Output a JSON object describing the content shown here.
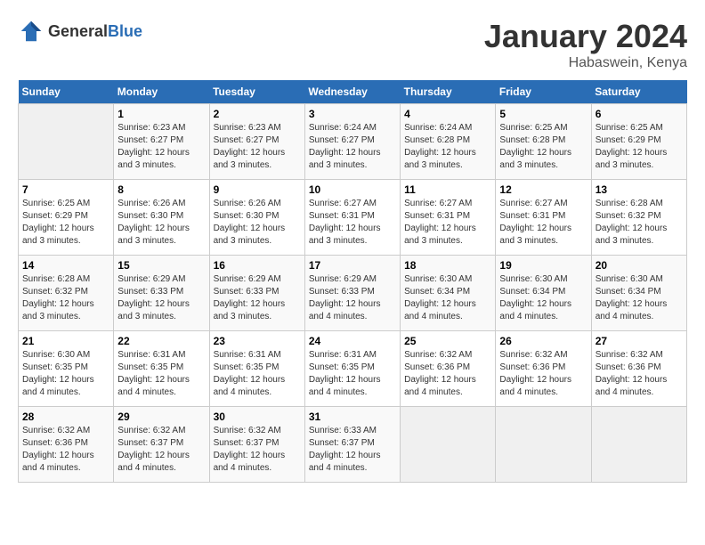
{
  "header": {
    "logo_general": "General",
    "logo_blue": "Blue",
    "month_title": "January 2024",
    "location": "Habaswein, Kenya"
  },
  "days_of_week": [
    "Sunday",
    "Monday",
    "Tuesday",
    "Wednesday",
    "Thursday",
    "Friday",
    "Saturday"
  ],
  "weeks": [
    [
      {
        "day": "",
        "empty": true
      },
      {
        "day": "1",
        "sunrise": "6:23 AM",
        "sunset": "6:27 PM",
        "daylight": "12 hours and 3 minutes."
      },
      {
        "day": "2",
        "sunrise": "6:23 AM",
        "sunset": "6:27 PM",
        "daylight": "12 hours and 3 minutes."
      },
      {
        "day": "3",
        "sunrise": "6:24 AM",
        "sunset": "6:27 PM",
        "daylight": "12 hours and 3 minutes."
      },
      {
        "day": "4",
        "sunrise": "6:24 AM",
        "sunset": "6:28 PM",
        "daylight": "12 hours and 3 minutes."
      },
      {
        "day": "5",
        "sunrise": "6:25 AM",
        "sunset": "6:28 PM",
        "daylight": "12 hours and 3 minutes."
      },
      {
        "day": "6",
        "sunrise": "6:25 AM",
        "sunset": "6:29 PM",
        "daylight": "12 hours and 3 minutes."
      }
    ],
    [
      {
        "day": "7",
        "sunrise": "6:25 AM",
        "sunset": "6:29 PM",
        "daylight": "12 hours and 3 minutes."
      },
      {
        "day": "8",
        "sunrise": "6:26 AM",
        "sunset": "6:30 PM",
        "daylight": "12 hours and 3 minutes."
      },
      {
        "day": "9",
        "sunrise": "6:26 AM",
        "sunset": "6:30 PM",
        "daylight": "12 hours and 3 minutes."
      },
      {
        "day": "10",
        "sunrise": "6:27 AM",
        "sunset": "6:31 PM",
        "daylight": "12 hours and 3 minutes."
      },
      {
        "day": "11",
        "sunrise": "6:27 AM",
        "sunset": "6:31 PM",
        "daylight": "12 hours and 3 minutes."
      },
      {
        "day": "12",
        "sunrise": "6:27 AM",
        "sunset": "6:31 PM",
        "daylight": "12 hours and 3 minutes."
      },
      {
        "day": "13",
        "sunrise": "6:28 AM",
        "sunset": "6:32 PM",
        "daylight": "12 hours and 3 minutes."
      }
    ],
    [
      {
        "day": "14",
        "sunrise": "6:28 AM",
        "sunset": "6:32 PM",
        "daylight": "12 hours and 3 minutes."
      },
      {
        "day": "15",
        "sunrise": "6:29 AM",
        "sunset": "6:33 PM",
        "daylight": "12 hours and 3 minutes."
      },
      {
        "day": "16",
        "sunrise": "6:29 AM",
        "sunset": "6:33 PM",
        "daylight": "12 hours and 3 minutes."
      },
      {
        "day": "17",
        "sunrise": "6:29 AM",
        "sunset": "6:33 PM",
        "daylight": "12 hours and 4 minutes."
      },
      {
        "day": "18",
        "sunrise": "6:30 AM",
        "sunset": "6:34 PM",
        "daylight": "12 hours and 4 minutes."
      },
      {
        "day": "19",
        "sunrise": "6:30 AM",
        "sunset": "6:34 PM",
        "daylight": "12 hours and 4 minutes."
      },
      {
        "day": "20",
        "sunrise": "6:30 AM",
        "sunset": "6:34 PM",
        "daylight": "12 hours and 4 minutes."
      }
    ],
    [
      {
        "day": "21",
        "sunrise": "6:30 AM",
        "sunset": "6:35 PM",
        "daylight": "12 hours and 4 minutes."
      },
      {
        "day": "22",
        "sunrise": "6:31 AM",
        "sunset": "6:35 PM",
        "daylight": "12 hours and 4 minutes."
      },
      {
        "day": "23",
        "sunrise": "6:31 AM",
        "sunset": "6:35 PM",
        "daylight": "12 hours and 4 minutes."
      },
      {
        "day": "24",
        "sunrise": "6:31 AM",
        "sunset": "6:35 PM",
        "daylight": "12 hours and 4 minutes."
      },
      {
        "day": "25",
        "sunrise": "6:32 AM",
        "sunset": "6:36 PM",
        "daylight": "12 hours and 4 minutes."
      },
      {
        "day": "26",
        "sunrise": "6:32 AM",
        "sunset": "6:36 PM",
        "daylight": "12 hours and 4 minutes."
      },
      {
        "day": "27",
        "sunrise": "6:32 AM",
        "sunset": "6:36 PM",
        "daylight": "12 hours and 4 minutes."
      }
    ],
    [
      {
        "day": "28",
        "sunrise": "6:32 AM",
        "sunset": "6:36 PM",
        "daylight": "12 hours and 4 minutes."
      },
      {
        "day": "29",
        "sunrise": "6:32 AM",
        "sunset": "6:37 PM",
        "daylight": "12 hours and 4 minutes."
      },
      {
        "day": "30",
        "sunrise": "6:32 AM",
        "sunset": "6:37 PM",
        "daylight": "12 hours and 4 minutes."
      },
      {
        "day": "31",
        "sunrise": "6:33 AM",
        "sunset": "6:37 PM",
        "daylight": "12 hours and 4 minutes."
      },
      {
        "day": "",
        "empty": true
      },
      {
        "day": "",
        "empty": true
      },
      {
        "day": "",
        "empty": true
      }
    ]
  ],
  "labels": {
    "sunrise_prefix": "Sunrise: ",
    "sunset_prefix": "Sunset: ",
    "daylight_prefix": "Daylight: "
  }
}
